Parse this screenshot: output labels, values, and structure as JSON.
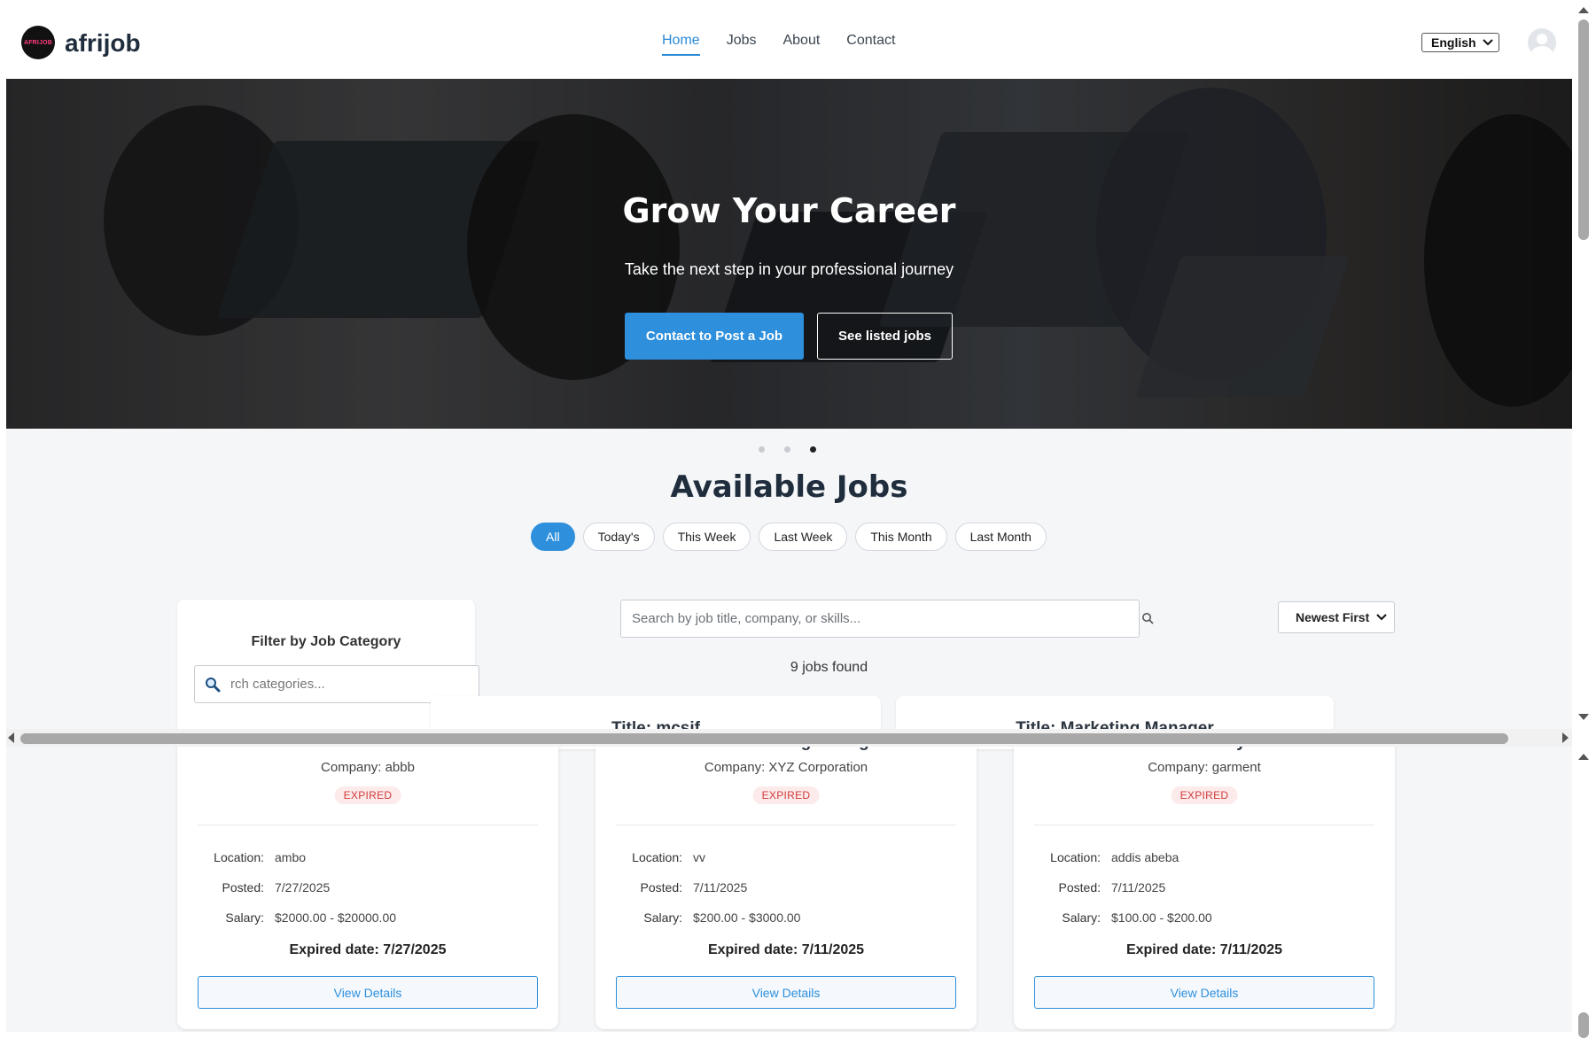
{
  "brand": {
    "logo_text": "afrijob",
    "logo_mark": "AFRIJOB"
  },
  "nav": [
    {
      "label": "Home"
    },
    {
      "label": "Jobs"
    },
    {
      "label": "About"
    },
    {
      "label": "Contact"
    }
  ],
  "language": {
    "selected": "English"
  },
  "hero": {
    "title": "Grow Your Career",
    "subtitle": "Take the next step in your professional journey",
    "primary_button": "Contact to Post a Job",
    "secondary_button": "See listed jobs",
    "slides_total": 3,
    "active_slide": 3
  },
  "jobs_section": {
    "title": "Available Jobs",
    "filters": [
      "All",
      "Today's",
      "This Week",
      "Last Week",
      "This Month",
      "Last Month"
    ],
    "active_filter": "All",
    "search_placeholder": "Search by job title, company, or skills...",
    "sort_selected": "Newest First",
    "jobs_found": "9 jobs found"
  },
  "sidebar": {
    "title": "Filter by Job Category",
    "search_placeholder": "rch categories..."
  },
  "top_cards": [
    {
      "title": "Title: mcsif"
    },
    {
      "title": "Title: Marketing Manager"
    }
  ],
  "cards": [
    {
      "title": "Title: mcsif",
      "company": "Company: abbb",
      "status": "EXPIRED",
      "location_label": "Location:",
      "location": "ambo",
      "posted_label": "Posted:",
      "posted": "7/27/2025",
      "salary_label": "Salary:",
      "salary": "$2000.00 - $20000.00",
      "expired": "Expired date: 7/27/2025",
      "button": "View Details"
    },
    {
      "title": "Title: Marketing Manager",
      "company": "Company: XYZ Corporation",
      "status": "EXPIRED",
      "location_label": "Location:",
      "location": "vv",
      "posted_label": "Posted:",
      "posted": "7/11/2025",
      "salary_label": "Salary:",
      "salary": "$200.00 - $3000.00",
      "expired": "Expired date: 7/11/2025",
      "button": "View Details"
    },
    {
      "title": "Title: abay",
      "company": "Company: garment",
      "status": "EXPIRED",
      "location_label": "Location:",
      "location": "addis abeba",
      "posted_label": "Posted:",
      "posted": "7/11/2025",
      "salary_label": "Salary:",
      "salary": "$100.00 - $200.00",
      "expired": "Expired date: 7/11/2025",
      "button": "View Details"
    }
  ],
  "colors": {
    "accent": "#2e8fdc",
    "expired_text": "#d23b3b",
    "expired_bg": "#fdeaea",
    "heading": "#1f2d3d"
  }
}
